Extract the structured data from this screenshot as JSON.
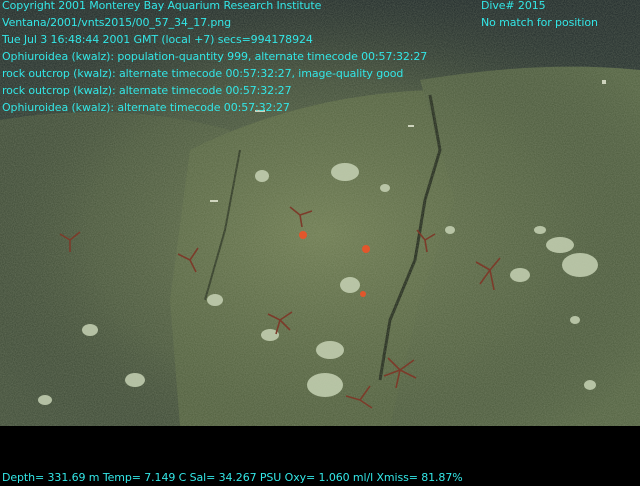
{
  "overlay": {
    "copyright": "Copyright 2001 Monterey Bay Aquarium Research Institute",
    "file_path": "Ventana/2001/vnts2015/00_57_34_17.png",
    "timestamp": "Tue Jul  3 16:48:44 2001 GMT (local +7)  secs=994178924",
    "annotations": [
      "Ophiuroidea (kwalz): population-quantity 999, alternate timecode 00:57:32:27",
      "rock outcrop (kwalz): alternate timecode 00:57:32:27, image-quality good",
      "rock outcrop (kwalz): alternate timecode 00:57:32:27",
      "Ophiuroidea (kwalz): alternate timecode 00:57:32:27"
    ],
    "dive_number": "Dive# 2015",
    "position_status": "No match for position",
    "telemetry": "Depth= 331.69 m  Temp= 7.149 C  Sal= 34.267 PSU  Oxy= 1.060 ml/l  Xmiss= 81.87%"
  },
  "colors": {
    "overlay_text": "#33e6e6",
    "water_dark": "#1c2a2a",
    "rock_green": "#4d5e3e",
    "sponge_white": "#c9d4b8",
    "starfish_red": "#e0502a",
    "brittle_star": "#7a3a2a"
  }
}
